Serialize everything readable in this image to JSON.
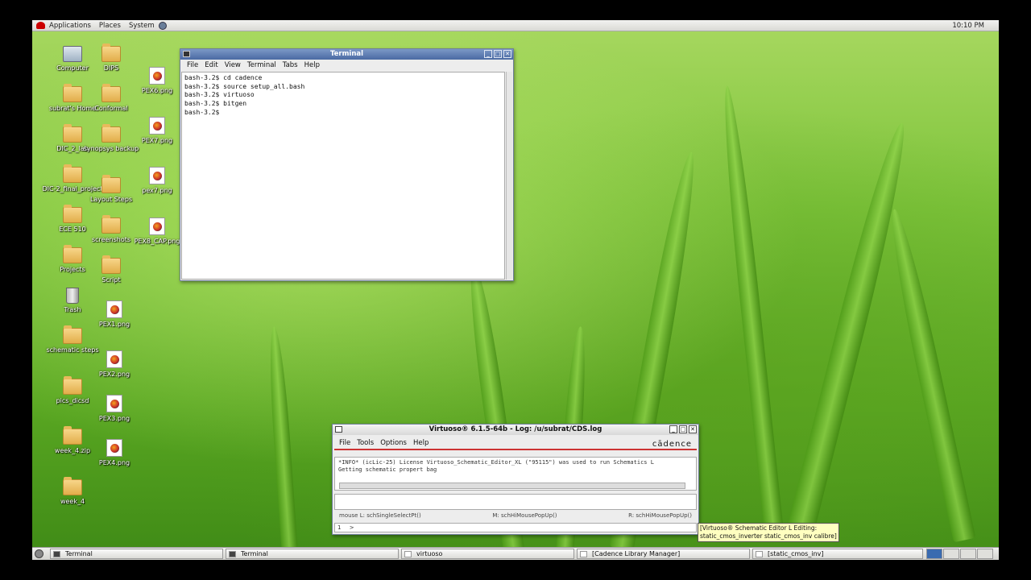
{
  "top_panel": {
    "menus": [
      "Applications",
      "Places",
      "System"
    ],
    "clock": "10:10 PM"
  },
  "desktop_icons": [
    {
      "label": "Computer",
      "kind": "computer"
    },
    {
      "label": "DIPS",
      "kind": "folder"
    },
    {
      "label": "PEX6.png",
      "kind": "png"
    },
    {
      "label": "subrat's Home",
      "kind": "home"
    },
    {
      "label": "Conformal",
      "kind": "folder"
    },
    {
      "label": "PEX7.png",
      "kind": "png"
    },
    {
      "label": "DIC_2_lab",
      "kind": "folder"
    },
    {
      "label": "synopsys backup",
      "kind": "folder"
    },
    {
      "label": "pex7.png",
      "kind": "png"
    },
    {
      "label": "DIC-2_final_project",
      "kind": "folder"
    },
    {
      "label": "Layout Steps",
      "kind": "folder"
    },
    {
      "label": "ECE 510",
      "kind": "folder"
    },
    {
      "label": "screenshots",
      "kind": "folder"
    },
    {
      "label": "PEX8_CAP.png",
      "kind": "png"
    },
    {
      "label": "Projects",
      "kind": "folder"
    },
    {
      "label": "Script",
      "kind": "folder"
    },
    {
      "label": "Trash",
      "kind": "trash"
    },
    {
      "label": "PEX1.png",
      "kind": "png"
    },
    {
      "label": "schematic steps",
      "kind": "folder"
    },
    {
      "label": "PEX2.png",
      "kind": "png"
    },
    {
      "label": "pics_dicsd",
      "kind": "folder"
    },
    {
      "label": "PEX3.png",
      "kind": "png"
    },
    {
      "label": "week_4.zip",
      "kind": "folder"
    },
    {
      "label": "PEX4.png",
      "kind": "png"
    },
    {
      "label": "week_4",
      "kind": "folder"
    }
  ],
  "terminal": {
    "title": "Terminal",
    "menus": [
      "File",
      "Edit",
      "View",
      "Terminal",
      "Tabs",
      "Help"
    ],
    "lines": [
      "bash-3.2$ cd cadence",
      "bash-3.2$ source setup_all.bash",
      "bash-3.2$ virtuoso",
      "bash-3.2$ bitgen",
      "bash-3.2$ "
    ]
  },
  "virtuoso": {
    "title": "Virtuoso® 6.1.5-64b - Log: /u/subrat/CDS.log",
    "menus": [
      "File",
      "Tools",
      "Options",
      "Help"
    ],
    "logo": "cādence",
    "log_lines": [
      "*INFO* (icLic-25) License Virtuoso_Schematic_Editor_XL (\"95115\") was used to run Schematics L",
      "Getting schematic propert bag"
    ],
    "mouse_left": "mouse L: schSingleSelectPt()",
    "mouse_middle": "M: schHiMousePopUp()",
    "mouse_right": "R: schHiMousePopUp()",
    "prompt_num": "1",
    "prompt": ">"
  },
  "tooltip": {
    "line1": "[Virtuoso® Schematic Editor L Editing:",
    "line2": "static_cmos_inverter static_cmos_inv calibre]"
  },
  "taskbar": [
    "Terminal",
    "Terminal",
    "virtuoso",
    "[Cadence Library Manager]",
    "[static_cmos_inv]"
  ]
}
